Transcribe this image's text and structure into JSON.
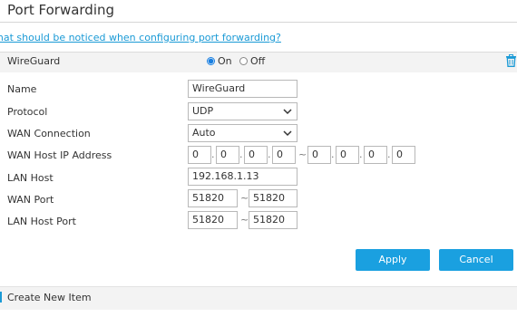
{
  "header": {
    "title": "Port Forwarding",
    "help_link": "What should be noticed when configuring port forwarding?"
  },
  "rule": {
    "name": "WireGuard",
    "toggle": {
      "on_label": "On",
      "off_label": "Off",
      "selected": "On"
    },
    "delete_icon": "trash-icon"
  },
  "form": {
    "name": {
      "label": "Name",
      "value": "WireGuard"
    },
    "protocol": {
      "label": "Protocol",
      "value": "UDP"
    },
    "wan_connection": {
      "label": "WAN Connection",
      "value": "Auto"
    },
    "wan_host_ip": {
      "label": "WAN Host IP Address",
      "start": [
        "0",
        "0",
        "0",
        "0"
      ],
      "end": [
        "0",
        "0",
        "0",
        "0"
      ],
      "dot": ".",
      "range_sep": "~"
    },
    "lan_host": {
      "label": "LAN Host",
      "value": "192.168.1.13"
    },
    "wan_port": {
      "label": "WAN Port",
      "start": "51820",
      "end": "51820",
      "sep": "~"
    },
    "lan_host_port": {
      "label": "LAN Host Port",
      "start": "51820",
      "end": "51820",
      "sep": "~"
    }
  },
  "actions": {
    "apply": "Apply",
    "cancel": "Cancel"
  },
  "footer": {
    "create_new": "Create New Item"
  },
  "colors": {
    "accent": "#1aa0e0",
    "link": "#1a9ad6",
    "radio": "#1a7fe0"
  }
}
